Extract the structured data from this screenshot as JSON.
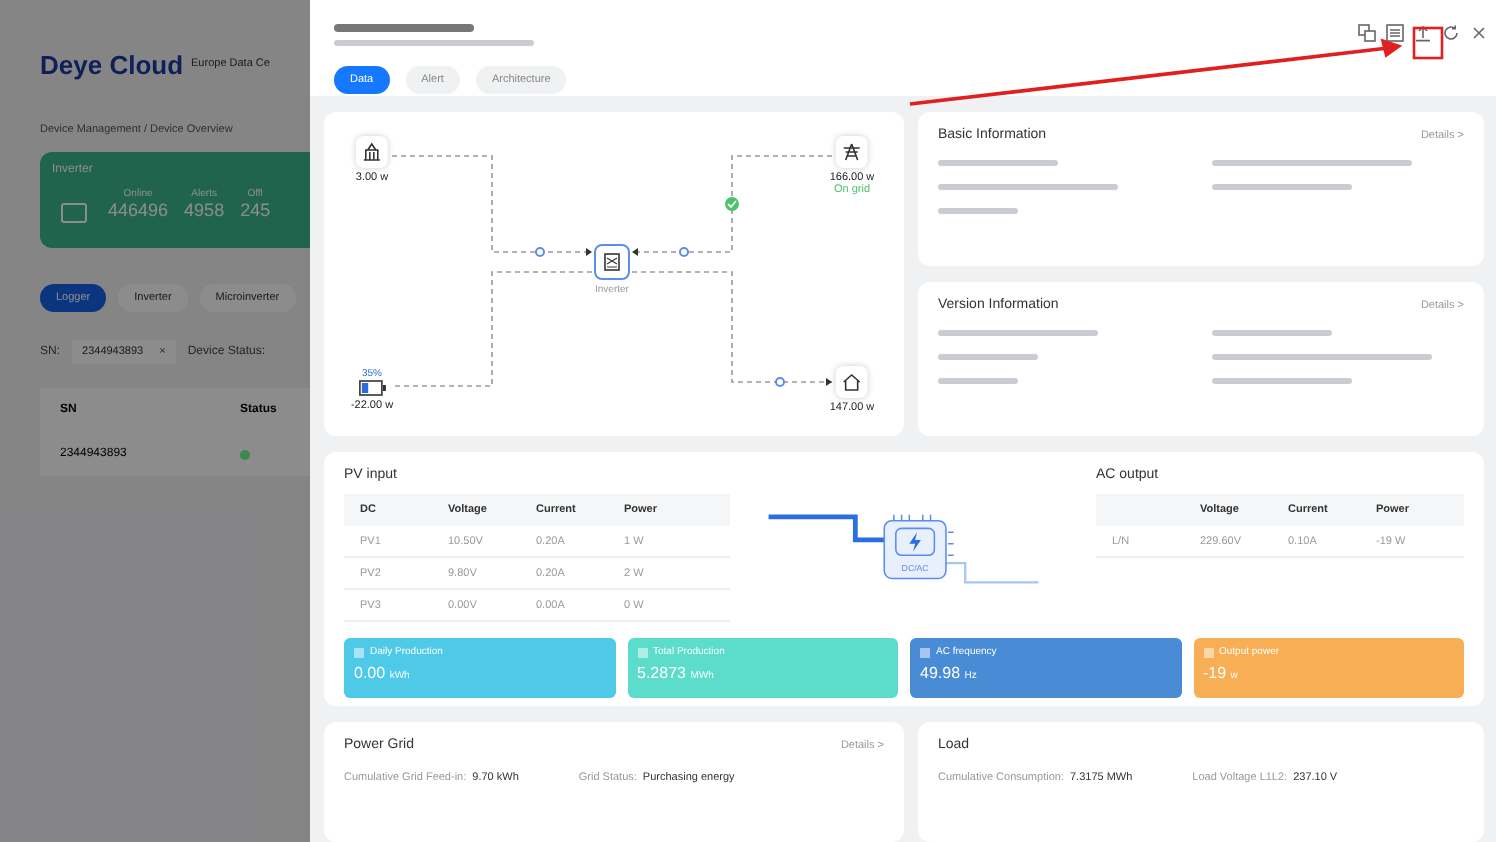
{
  "background_page": {
    "logo": "Deye Cloud",
    "region": "Europe Data Ce",
    "breadcrumb": "Device Management / Device Overview",
    "summary_card": {
      "title": "Inverter",
      "stats": [
        {
          "label": "Online",
          "value": "446496"
        },
        {
          "label": "Alerts",
          "value": "4958"
        },
        {
          "label": "Offl",
          "value": "245"
        }
      ]
    },
    "tabs": [
      {
        "label": "Logger",
        "selected": true
      },
      {
        "label": "Inverter",
        "selected": false
      },
      {
        "label": "Microinverter",
        "selected": false
      }
    ],
    "filter": {
      "label": "SN:",
      "value": "2344943893",
      "clear": "×",
      "status_label": "Device Status:"
    },
    "table": {
      "columns": [
        "SN",
        "Status"
      ],
      "rows": [
        {
          "sn": "2344943893",
          "color": "#3a8a4a"
        }
      ]
    }
  },
  "drawer": {
    "tabs": [
      {
        "label": "Data",
        "selected": true
      },
      {
        "label": "Alert",
        "selected": false
      },
      {
        "label": "Architecture",
        "selected": false
      }
    ],
    "flow": {
      "solar": {
        "reading": "3.00 w"
      },
      "grid": {
        "reading": "166.00 w",
        "status": "On grid"
      },
      "inverter": {
        "label": "Inverter"
      },
      "battery": {
        "percent": "35%",
        "level": 0.35,
        "reading": "-22.00 w"
      },
      "load": {
        "reading": "147.00 w"
      }
    },
    "basic_info": {
      "title": "Basic Information",
      "link": "Details >"
    },
    "version_info": {
      "title": "Version Information",
      "link": "Details >"
    },
    "pv_input": {
      "title": "PV input",
      "columns": [
        "DC",
        "Voltage",
        "Current",
        "Power"
      ],
      "rows": [
        [
          "PV1",
          "10.50V",
          "0.20A",
          "1 W"
        ],
        [
          "PV2",
          "9.80V",
          "0.20A",
          "2 W"
        ],
        [
          "PV3",
          "0.00V",
          "0.00A",
          "0 W"
        ]
      ]
    },
    "converter_label": "DC/AC",
    "ac_output": {
      "title": "AC output",
      "columns": [
        "",
        "Voltage",
        "Current",
        "Power"
      ],
      "rows": [
        [
          "L/N",
          "229.60V",
          "0.10A",
          "-19 W"
        ]
      ]
    },
    "tiles": [
      {
        "label": "Daily Production",
        "value": "0.00",
        "unit": "kWh",
        "color": "#4fc9e8"
      },
      {
        "label": "Total Production",
        "value": "5.2873",
        "unit": "MWh",
        "color": "#5cdccb"
      },
      {
        "label": "AC frequency",
        "value": "49.98",
        "unit": "Hz",
        "color": "#4a8bd6"
      },
      {
        "label": "Output power",
        "value": "-19",
        "unit": "w",
        "color": "#f8ae55"
      }
    ],
    "power_grid": {
      "title": "Power Grid",
      "link": "Details >",
      "fields": [
        {
          "label": "Cumulative Grid Feed-in:",
          "value": "9.70 kWh"
        },
        {
          "label": "Grid Status:",
          "value": "Purchasing energy"
        }
      ]
    },
    "load": {
      "title": "Load",
      "fields": [
        {
          "label": "Cumulative Consumption:",
          "value": "7.3175 MWh"
        },
        {
          "label": "Load Voltage L1L2:",
          "value": "237.10 V"
        }
      ]
    }
  }
}
